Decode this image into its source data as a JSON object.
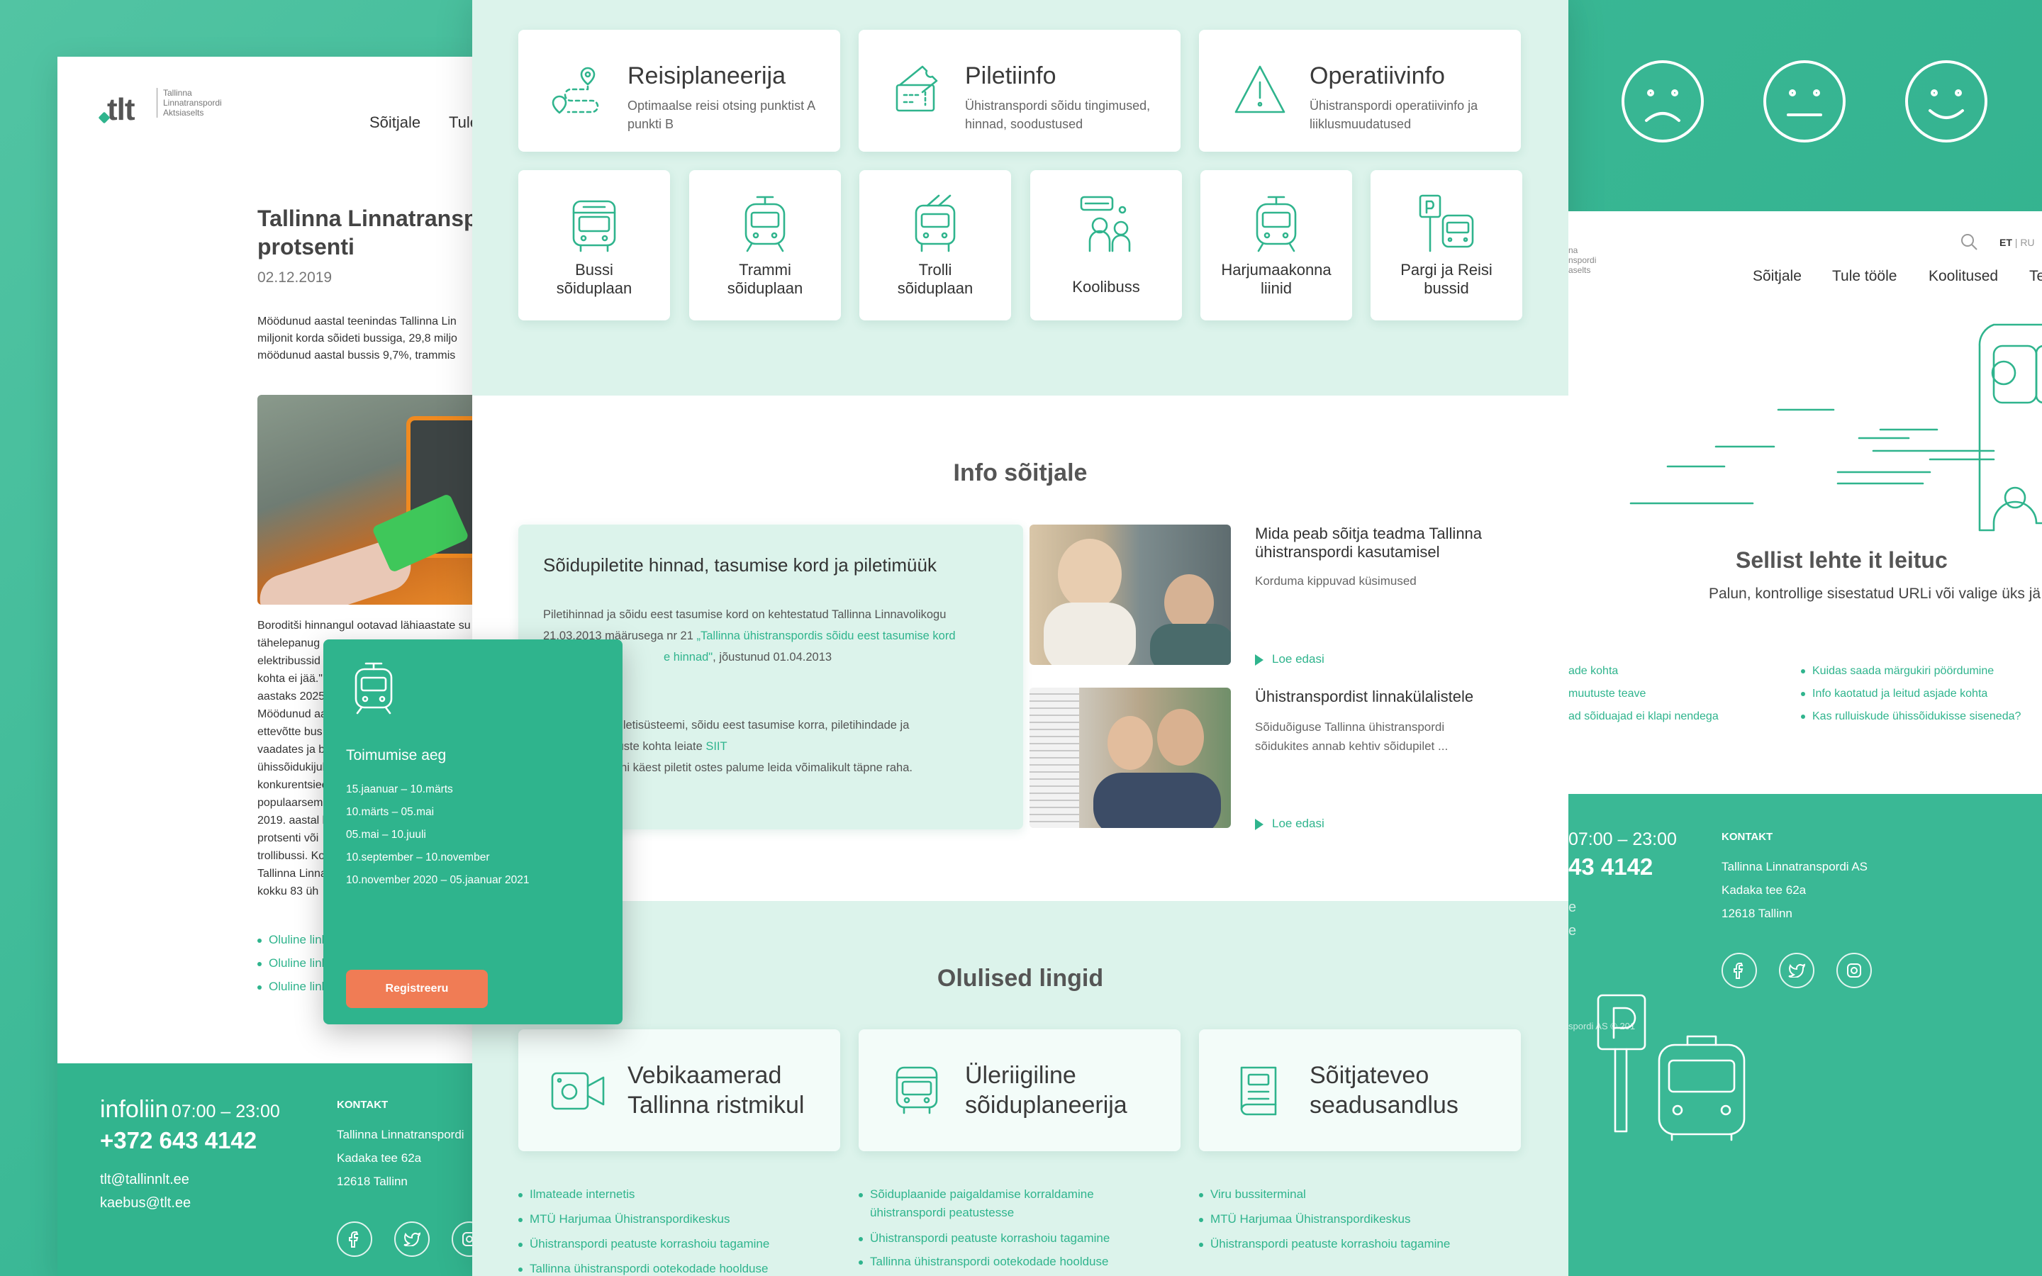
{
  "colors": {
    "brand": "#2fb48d",
    "accent_button": "#f07c55",
    "light_section": "#dcf3eb"
  },
  "left_page": {
    "logo_text": "tlt",
    "logo_company_lines": [
      "Tallinna",
      "Linnatranspordi",
      "Aktsiaselts"
    ],
    "nav": [
      "Sõitjale",
      "Tule"
    ],
    "article_title": "Tallinna Linnatranspo",
    "article_title_line2": "protsenti",
    "date": "02.12.2019",
    "intro_lines": [
      "Möödunud aastal teenindas Tallinna Lin",
      "miljonit korda sõideti bussiga, 29,8 miljo",
      "möödunud aastal bussis 9,7%, trammis"
    ],
    "body_lines": [
      "Boroditši hinnangul ootavad lähiaastate su",
      "tähelepanug",
      "elektribussid",
      "kohta ei jää.\"",
      "aastaks 2025",
      "Möödunud aa",
      "ettevõtte bus",
      "vaadates ja b",
      "ühissõidukijul",
      "konkurentsiee",
      "populaarsem",
      "2019. aastal k",
      "protsenti või",
      "trollibussi. Ko",
      "Tallinna Linna",
      "kokku 83 üh"
    ],
    "links": [
      "Oluline link",
      "Oluline link",
      "Oluline link"
    ],
    "footer": {
      "infoline_label": "infoliin",
      "infoline_hours": "07:00 – 23:00",
      "phone": "+372 643 4142",
      "emails": [
        "tlt@tallinnlt.ee",
        "kaebus@tlt.ee"
      ],
      "contact_heading": "KONTAKT",
      "contact_lines": [
        "Tallinna Linnatranspordi",
        "Kadaka tee 62a",
        "12618 Tallinn"
      ]
    }
  },
  "top_cards": [
    {
      "icon": "route-planner-icon",
      "title": "Reisiplaneerija",
      "sub": [
        "Optimaalse reisi otsing punktist A",
        "punkti B"
      ]
    },
    {
      "icon": "ticket-icon",
      "title": "Piletiinfo",
      "sub": [
        "Ühistranspordi sõidu tingimused,",
        "hinnad, soodustused"
      ]
    },
    {
      "icon": "warning-icon",
      "title": "Operatiivinfo",
      "sub": [
        "Ühistranspordi operatiivinfo ja",
        "liiklusmuudatused"
      ]
    }
  ],
  "tiles": [
    {
      "icon": "bus-icon",
      "label": [
        "Bussi",
        "sõiduplaan"
      ]
    },
    {
      "icon": "tram-icon",
      "label": [
        "Trammi",
        "sõiduplaan"
      ]
    },
    {
      "icon": "trolley-icon",
      "label": [
        "Trolli",
        "sõiduplaan"
      ]
    },
    {
      "icon": "school-bus-icon",
      "label": [
        "Koolibuss"
      ]
    },
    {
      "icon": "county-line-icon",
      "label": [
        "Harjumaakonna",
        "liinid"
      ]
    },
    {
      "icon": "park-ride-icon",
      "label": [
        "Pargi ja Reisi",
        "bussid"
      ]
    }
  ],
  "info": {
    "heading": "Info sõitjale",
    "card_title": "Sõidupiletite hinnad, tasumise kord ja piletimüük",
    "p1_a": "Piletihinnad ja sõidu eest tasumise kord on kehtestatud Tallinna Linnavolikogu",
    "p1_b": "21.03.2013 määrusega nr 21 ",
    "p1_link": "„Tallinna ühistranspordis sõidu eest tasumise kord",
    "p1_link2": "e hinnad\"",
    "p1_c": ", jõustunud 01.04.2013",
    "p2_a": "piletisüsteemi, sõidu eest tasumise korra, piletihindade ja",
    "p2_b": "tuste kohta leiate ",
    "p2_link": "SIIT",
    "p3": "uhi käest piletit ostes palume leida võimalikult täpne raha.",
    "articles": [
      {
        "title": [
          "Mida peab sõitja teadma Tallinna",
          "ühistranspordi kasutamisel"
        ],
        "desc": [
          "Korduma kippuvad küsimused"
        ],
        "more": "Loe edasi"
      },
      {
        "title": [
          "Ühistranspordist linnakülalistele"
        ],
        "desc": [
          "Sõiduõiguse Tallinna ühistranspordi",
          "sõidukites annab kehtiv sõidupilet ..."
        ],
        "more": "Loe edasi"
      }
    ]
  },
  "links_section": {
    "heading": "Olulised lingid",
    "cards": [
      {
        "icon": "webcam-icon",
        "title": [
          "Vebikaamerad",
          "Tallinna ristmikul"
        ]
      },
      {
        "icon": "international-bus-icon",
        "title": [
          "Üleriigiline",
          "sõiduplaneerija"
        ]
      },
      {
        "icon": "law-book-icon",
        "title": [
          "Sõitjateveo",
          "seadusandlus"
        ]
      }
    ],
    "col1": [
      "Ilmateade internetis",
      "MTÜ Harjumaa Ühistranspordikeskus",
      "Ühistranspordi peatuste korrashoiu tagamine",
      "Tallinna ühistranspordi ootekodade hoolduse"
    ],
    "col2": [
      "Sõiduplaanide paigaldamise korraldamine",
      "ühistranspordi peatustesse",
      "Ühistranspordi peatuste korrashoiu tagamine",
      "Tallinna ühistranspordi ootekodade hoolduse"
    ],
    "col3": [
      "Viru bussiterminal",
      "MTÜ Harjumaa Ühistranspordikeskus",
      "Ühistranspordi peatuste korrashoiu tagamine"
    ]
  },
  "overlay": {
    "title": "Toimumise aeg",
    "dates": [
      "15.jaanuar – 10.märts",
      "10.märts – 05.mai",
      "05.mai – 10.juuli",
      "10.september – 10.november",
      "10.november 2020 – 05.jaanuar 2021"
    ],
    "button": "Registreeru"
  },
  "right_page": {
    "logo_lines": [
      "na",
      "nspordi",
      "aselts"
    ],
    "lang": {
      "et": "ET",
      "ru": "RU"
    },
    "nav": [
      "Sõitjale",
      "Tule tööle",
      "Koolitused",
      "Te"
    ],
    "error_title": "Sellist lehte it leituc",
    "error_text": "Palun, kontrollige sisestatud URLi või valige üks jä",
    "links_left": [
      "ade kohta",
      "muutuste teave",
      "ad sõiduajad ei klapi nendega"
    ],
    "links_right": [
      "Kuidas saada märgukiri pöördumine",
      "Info kaotatud ja leitud asjade kohta",
      "Kas rulluiskude ühissõidukisse siseneda?"
    ],
    "footer": {
      "hours": "07:00 – 23:00",
      "phone_part": "43 4142",
      "contact_heading": "KONTAKT",
      "contact_lines": [
        "Tallinna Linnatranspordi AS",
        "Kadaka tee 62a",
        "12618 Tallinn"
      ],
      "copyright_part": "spordi AS © 201",
      "stub_lines": [
        "e",
        "e"
      ]
    }
  },
  "feedback_faces": [
    "sad-face-icon",
    "neutral-face-icon",
    "happy-face-icon"
  ]
}
